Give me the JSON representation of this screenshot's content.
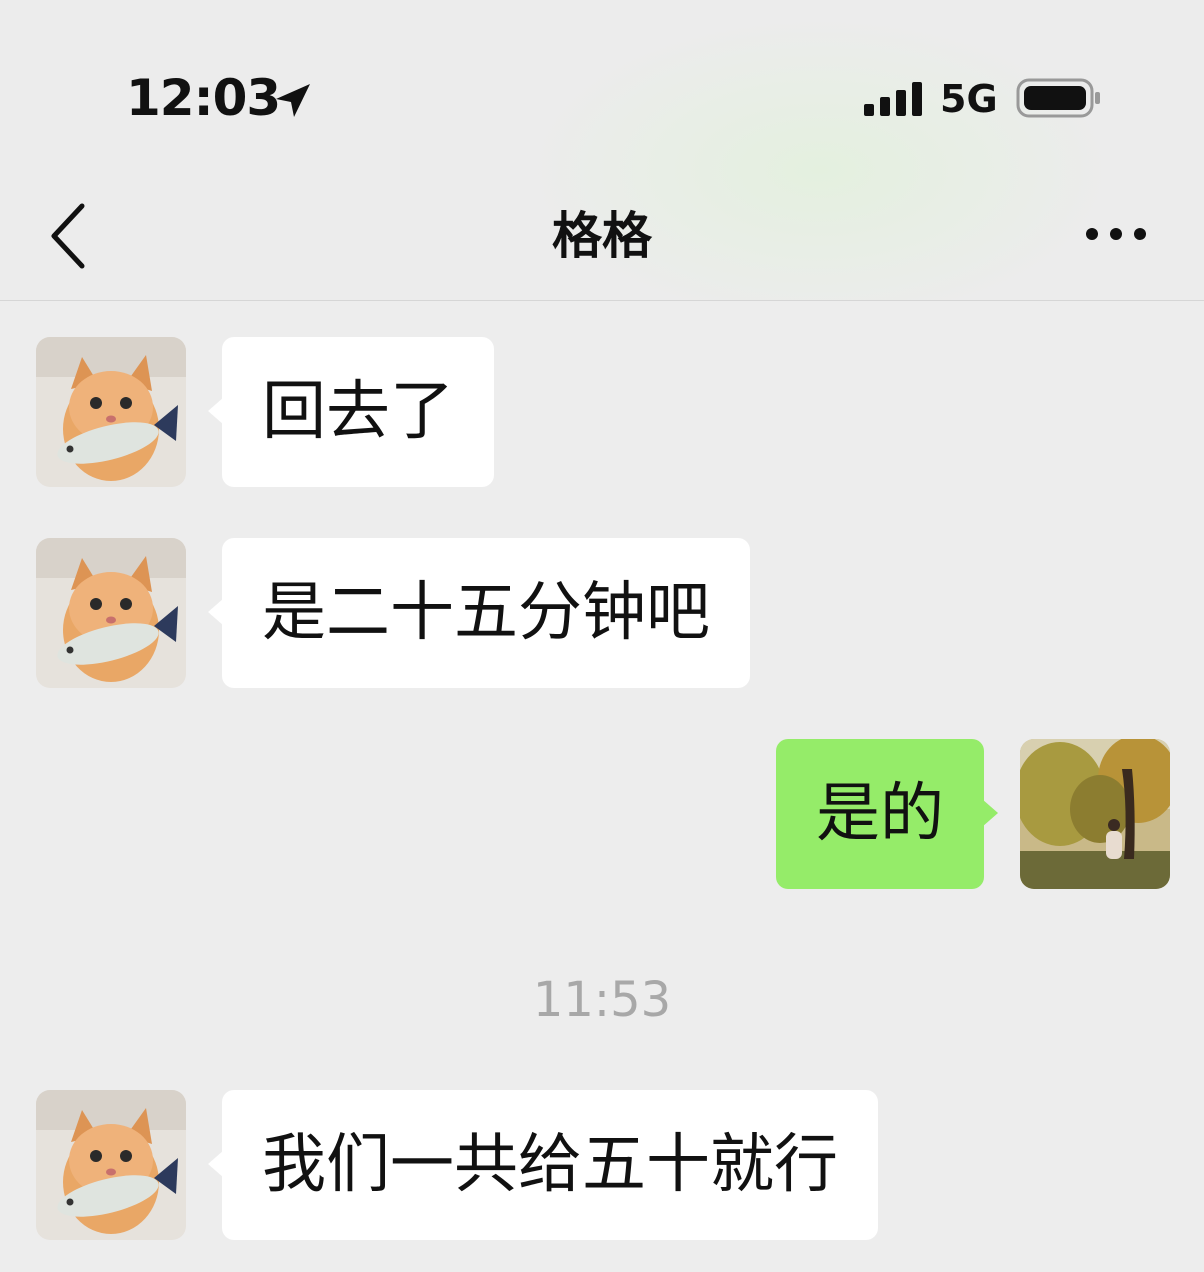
{
  "status_bar": {
    "time": "12:03",
    "network": "5G",
    "location_icon": "location-arrow-icon",
    "signal_icon": "cellular-signal-icon",
    "battery_icon": "battery-icon"
  },
  "header": {
    "title": "格格",
    "back_icon": "chevron-left-icon",
    "more_icon": "ellipsis-icon"
  },
  "messages": [
    {
      "side": "left",
      "text": "回去了",
      "avatar": "cat-with-fish-avatar"
    },
    {
      "side": "left",
      "text": "是二十五分钟吧",
      "avatar": "cat-with-fish-avatar"
    },
    {
      "side": "right",
      "text": "是的",
      "avatar": "willow-tree-photo-avatar"
    },
    {
      "type": "timestamp",
      "text": "11:53"
    },
    {
      "side": "left",
      "text": "我们一共给五十就行",
      "avatar": "cat-with-fish-avatar"
    }
  ],
  "colors": {
    "background": "#ededed",
    "incoming_bubble": "#ffffff",
    "outgoing_bubble": "#95ec69",
    "timestamp_text": "#a8a8a8"
  }
}
